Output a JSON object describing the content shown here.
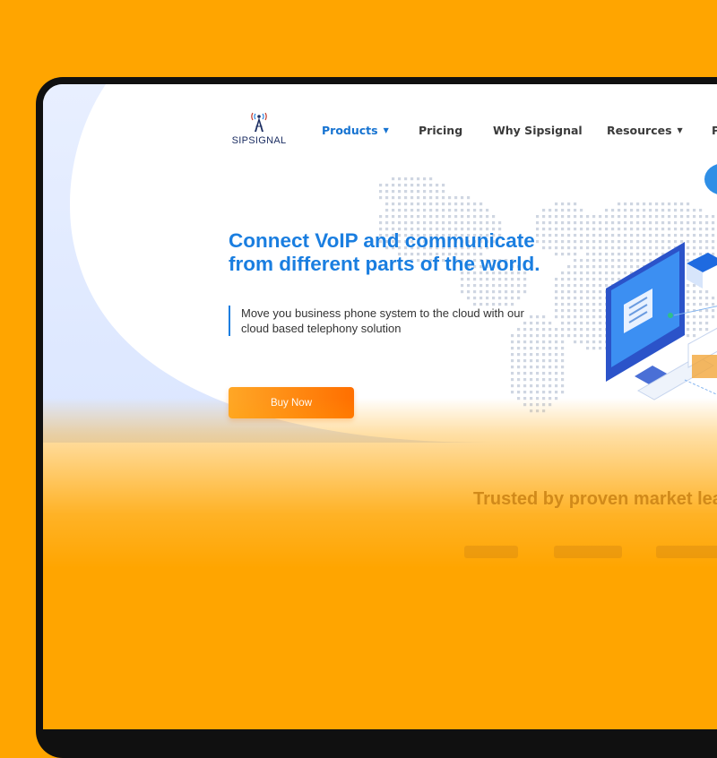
{
  "brand": {
    "name": "SIPSIGNAL",
    "logo_icon": "radio-tower-icon",
    "colors": {
      "accent": "#1a7ee0",
      "brand_navy": "#1d2f63",
      "orange": "#ffa500"
    }
  },
  "nav": {
    "items": [
      {
        "label": "Products",
        "active": true,
        "dropdown": true
      },
      {
        "label": "Pricing",
        "active": false,
        "dropdown": false
      },
      {
        "label": "Why Sipsignal",
        "active": false,
        "dropdown": false
      },
      {
        "label": "Resources",
        "active": false,
        "dropdown": true
      },
      {
        "label": "P",
        "active": false,
        "dropdown": false
      }
    ],
    "dropdown_icon": "caret-down-icon"
  },
  "hero": {
    "headline_line1": "Connect VoIP and communicate",
    "headline_line2": "from different parts of the world.",
    "subtitle_line1": "Move you business phone system to the cloud with our",
    "subtitle_line2": "cloud based telephony solution",
    "cta_label": "Buy Now",
    "illustration": "isometric-computer-illustration"
  },
  "trusted": {
    "heading": "Trusted by proven market lea"
  }
}
